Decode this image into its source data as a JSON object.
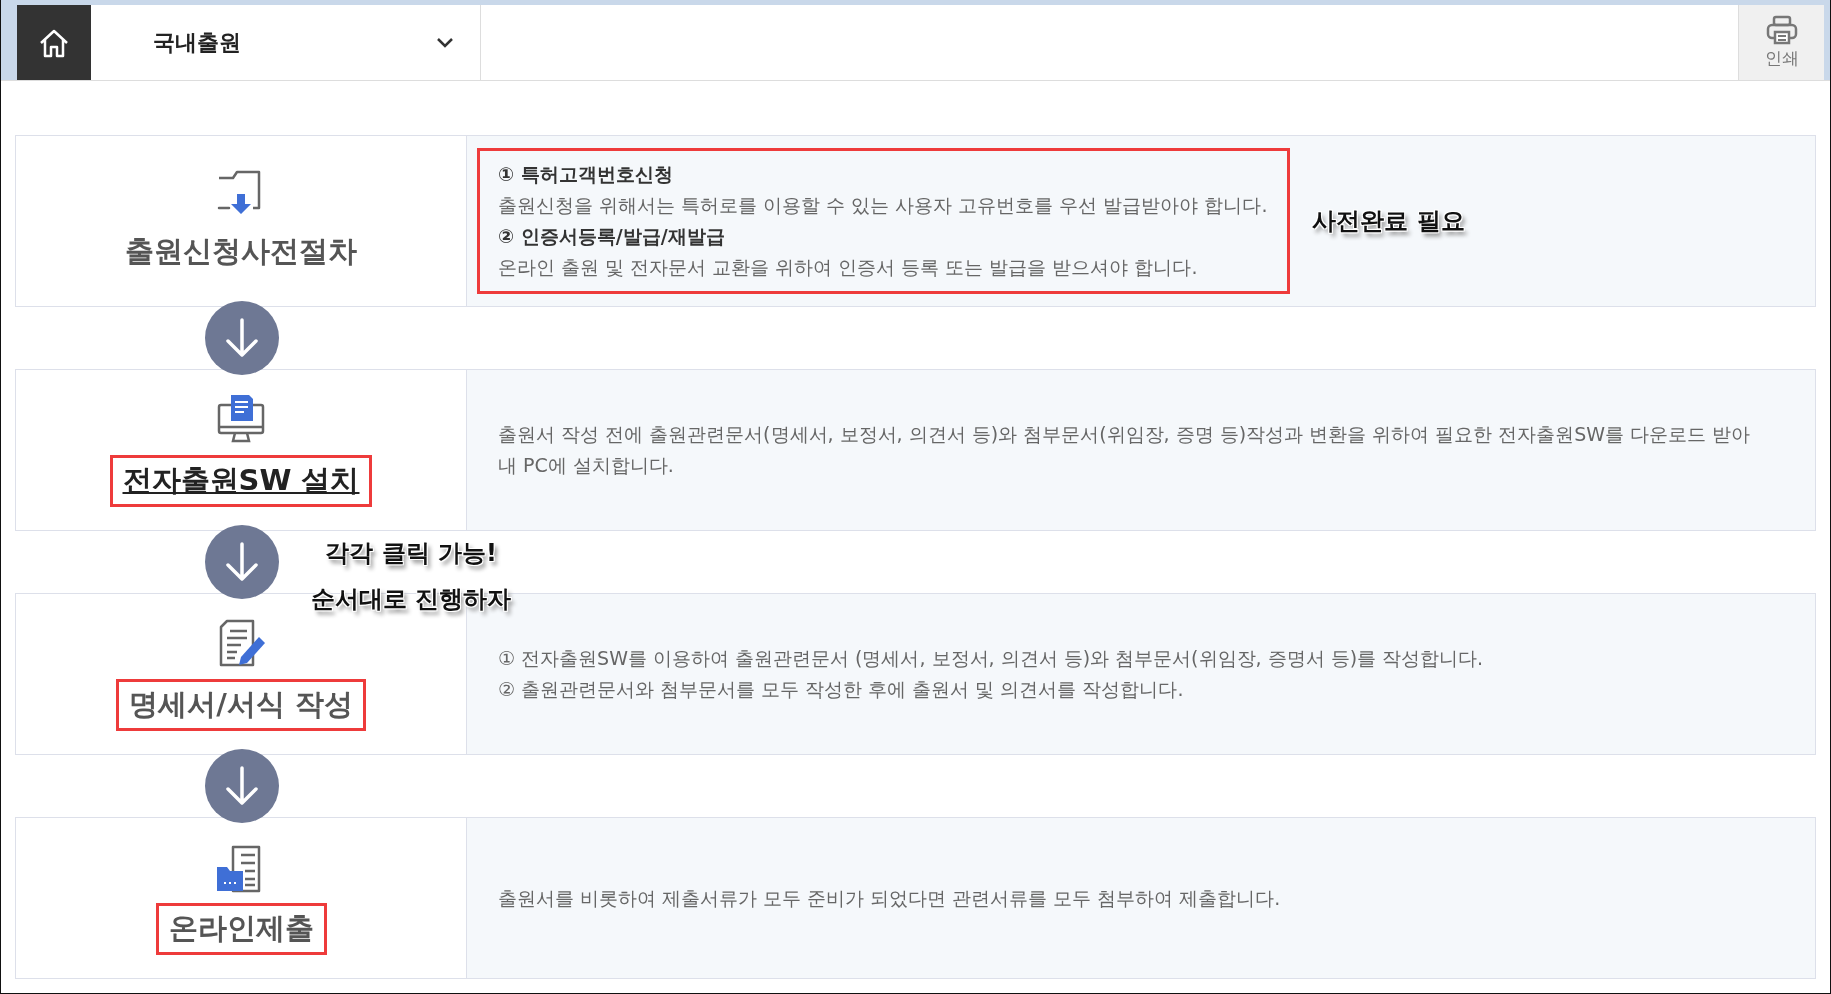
{
  "header": {
    "dropdown": {
      "value": "국내출원"
    },
    "print_button": {
      "label": "인쇄"
    }
  },
  "steps": [
    {
      "kind": "folder",
      "title": "출원신청사전절차",
      "link": false,
      "highlighted": false,
      "description_highlighted": true,
      "note": "사전완료 필요",
      "lines": [
        {
          "kind": "heading",
          "text": "① 특허고객번호신청"
        },
        {
          "kind": "text",
          "text": "출원신청을 위해서는 특허로를 이용할 수 있는 사용자 고유번호를 우선 발급받아야 합니다."
        },
        {
          "kind": "heading",
          "text": "② 인증서등록/발급/재발급"
        },
        {
          "kind": "text",
          "text": "온라인 출원 및 전자문서 교환을 위하여 인증서 등록 또는 발급을 받으셔야 합니다."
        }
      ]
    },
    {
      "kind": "monitor",
      "title": "전자출원SW 설치",
      "link": true,
      "highlighted": true,
      "description_highlighted": false,
      "lines": [
        {
          "kind": "text",
          "text": "출원서 작성 전에 출원관련문서(명세서, 보정서, 의견서 등)와 첨부문서(위임장, 증명 등)작성과 변환을 위하여 필요한 전자출원SW를 다운로드 받아 내 PC에 설치합니다."
        }
      ]
    },
    {
      "kind": "edit",
      "title": "명세서/서식 작성",
      "link": false,
      "highlighted": true,
      "description_highlighted": false,
      "lines": [
        {
          "kind": "text",
          "text": "① 전자출원SW를 이용하여 출원관련문서 (명세서, 보정서, 의견서 등)와 첨부문서(위임장, 증명서 등)를 작성합니다."
        },
        {
          "kind": "text",
          "text": "② 출원관련문서와 첨부문서를 모두 작성한 후에 출원서 및 의견서를 작성합니다."
        }
      ]
    },
    {
      "kind": "submit",
      "title": "온라인제출",
      "link": false,
      "highlighted": true,
      "description_highlighted": false,
      "lines": [
        {
          "kind": "text",
          "text": "출원서를 비롯하여 제출서류가 모두 준비가 되었다면 관련서류를 모두 첨부하여 제출합니다."
        }
      ]
    }
  ],
  "callout": [
    "각각 클릭 가능!",
    "순서대로 진행하자"
  ]
}
